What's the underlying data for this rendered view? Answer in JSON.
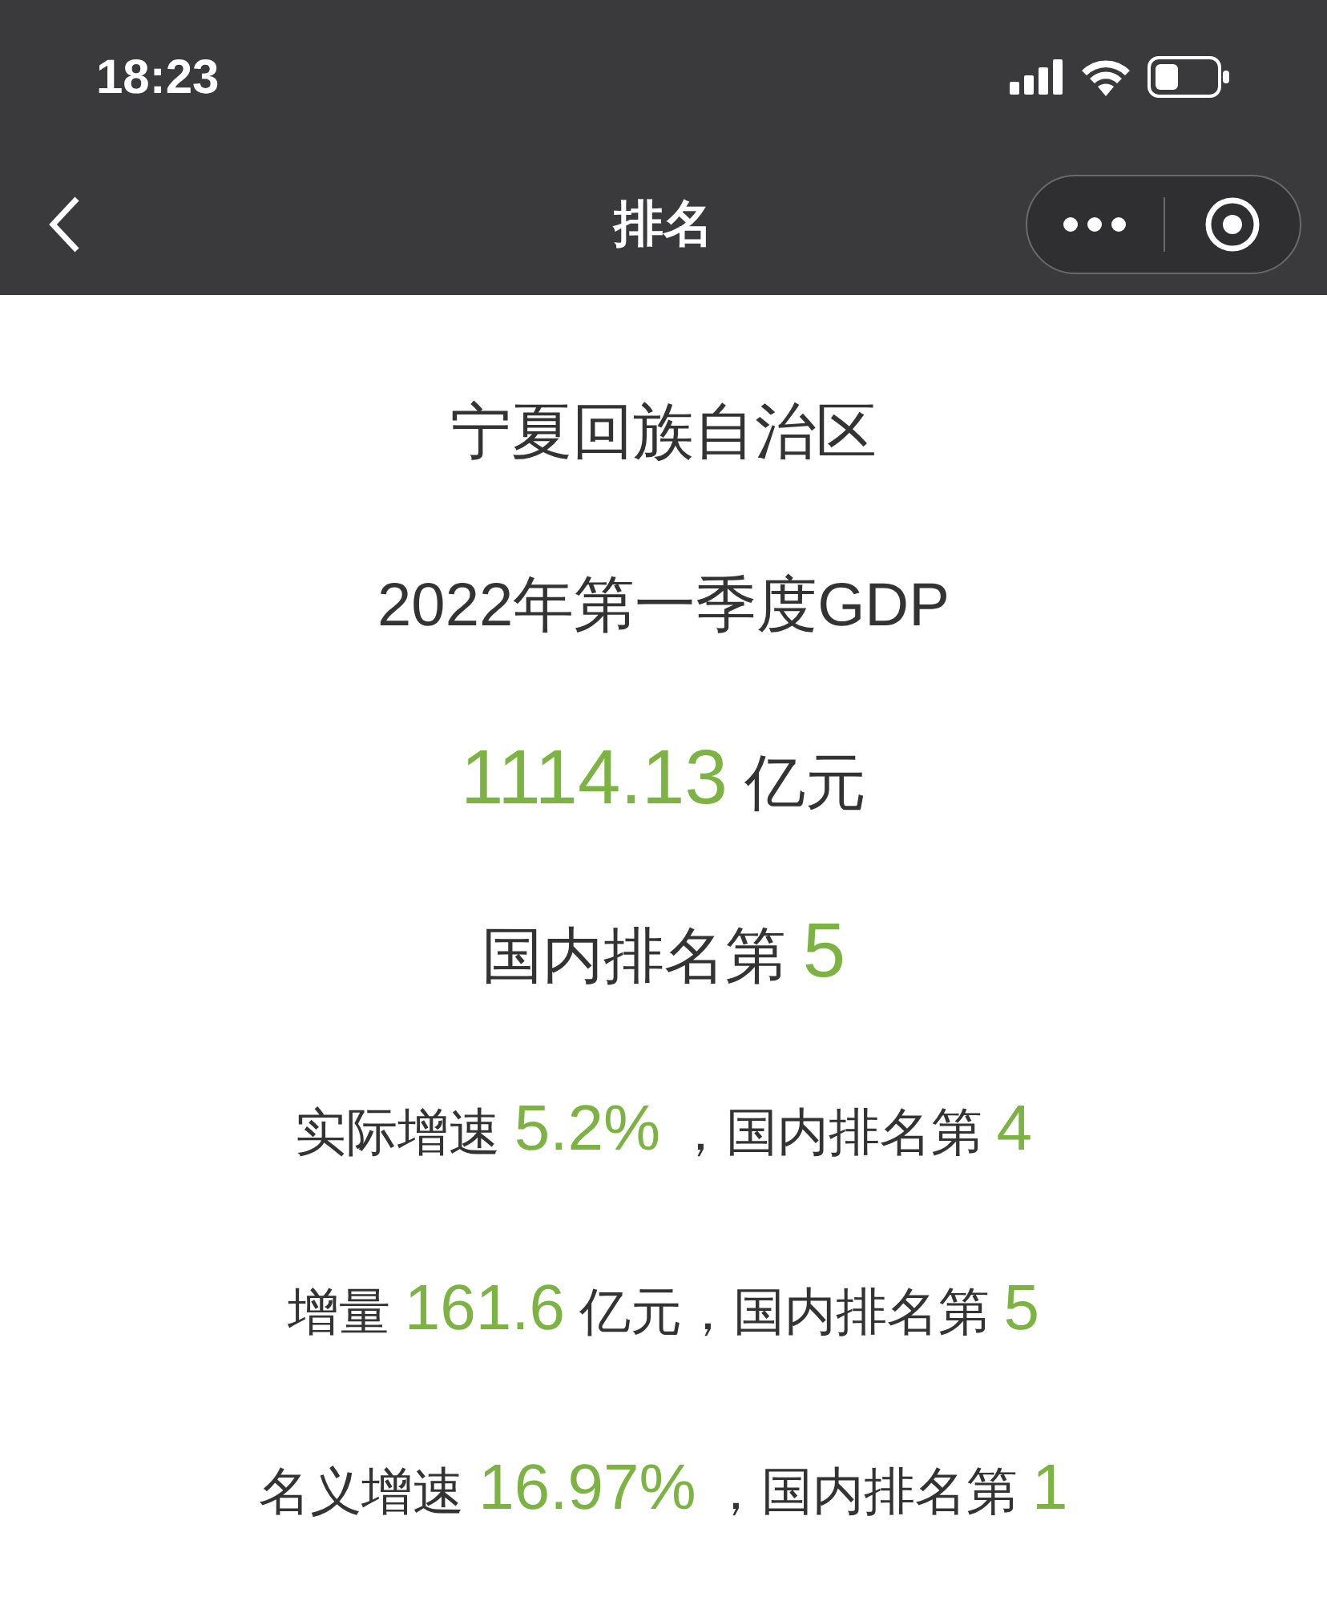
{
  "status_bar": {
    "time": "18:23"
  },
  "nav_bar": {
    "title": "排名"
  },
  "lines": [
    {
      "kind": "headline",
      "segments": [
        {
          "text": "宁夏回族自治区",
          "highlighted": false
        }
      ]
    },
    {
      "kind": "headline",
      "segments": [
        {
          "text": "2022年第一季度GDP",
          "highlighted": false
        }
      ]
    },
    {
      "kind": "headline",
      "segments": [
        {
          "text": "1114.13",
          "highlighted": true
        },
        {
          "text": " 亿元",
          "highlighted": false
        }
      ]
    },
    {
      "kind": "headline",
      "segments": [
        {
          "text": "国内排名第 ",
          "highlighted": false
        },
        {
          "text": "5",
          "highlighted": true
        }
      ]
    },
    {
      "kind": "detail",
      "segments": [
        {
          "text": "实际增速 ",
          "highlighted": false
        },
        {
          "text": "5.2%",
          "highlighted": true
        },
        {
          "text": " ，国内排名第 ",
          "highlighted": false
        },
        {
          "text": "4",
          "highlighted": true
        }
      ]
    },
    {
      "kind": "detail",
      "segments": [
        {
          "text": "增量 ",
          "highlighted": false
        },
        {
          "text": "161.6",
          "highlighted": true
        },
        {
          "text": " 亿元，国内排名第 ",
          "highlighted": false
        },
        {
          "text": "5",
          "highlighted": true
        }
      ]
    },
    {
      "kind": "detail",
      "segments": [
        {
          "text": "名义增速 ",
          "highlighted": false
        },
        {
          "text": "16.97%",
          "highlighted": true
        },
        {
          "text": " ，国内排名第 ",
          "highlighted": false
        },
        {
          "text": "1",
          "highlighted": true
        }
      ]
    }
  ]
}
